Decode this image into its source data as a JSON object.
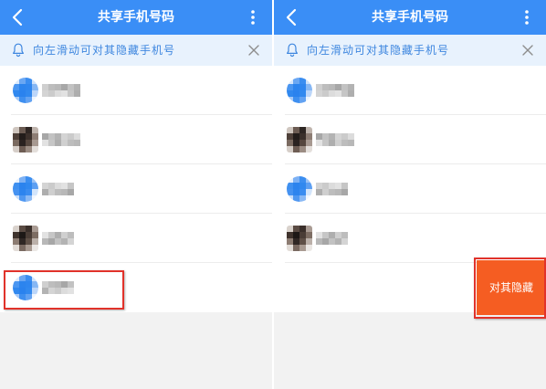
{
  "header": {
    "title": "共享手机号码",
    "back_icon": "chevron-left-icon",
    "menu_icon": "more-vertical-icon"
  },
  "notice": {
    "icon": "bell-icon",
    "text": "向左滑动可对其隐藏手机号",
    "close_icon": "close-icon"
  },
  "contacts": [
    {
      "avatar": "default-avatar",
      "name_masked": true
    },
    {
      "avatar": "photo-avatar",
      "name_masked": true
    },
    {
      "avatar": "default-avatar",
      "name_masked": true
    },
    {
      "avatar": "photo-avatar",
      "name_masked": true
    },
    {
      "avatar": "default-avatar",
      "name_masked": true
    }
  ],
  "screens": [
    {
      "swiped_row": null,
      "highlighted_row": 5
    },
    {
      "swiped_row": 5,
      "highlighted_row": 5,
      "swipe_action": {
        "label": "对其隐藏"
      }
    }
  ],
  "colors": {
    "header_bg": "#3a8ef6",
    "notice_bg": "#e8f2fd",
    "notice_text": "#3d86df",
    "swipe_action_bg": "#f55d22",
    "highlight_border": "#e1322a",
    "page_bg": "#f2f2f2"
  }
}
